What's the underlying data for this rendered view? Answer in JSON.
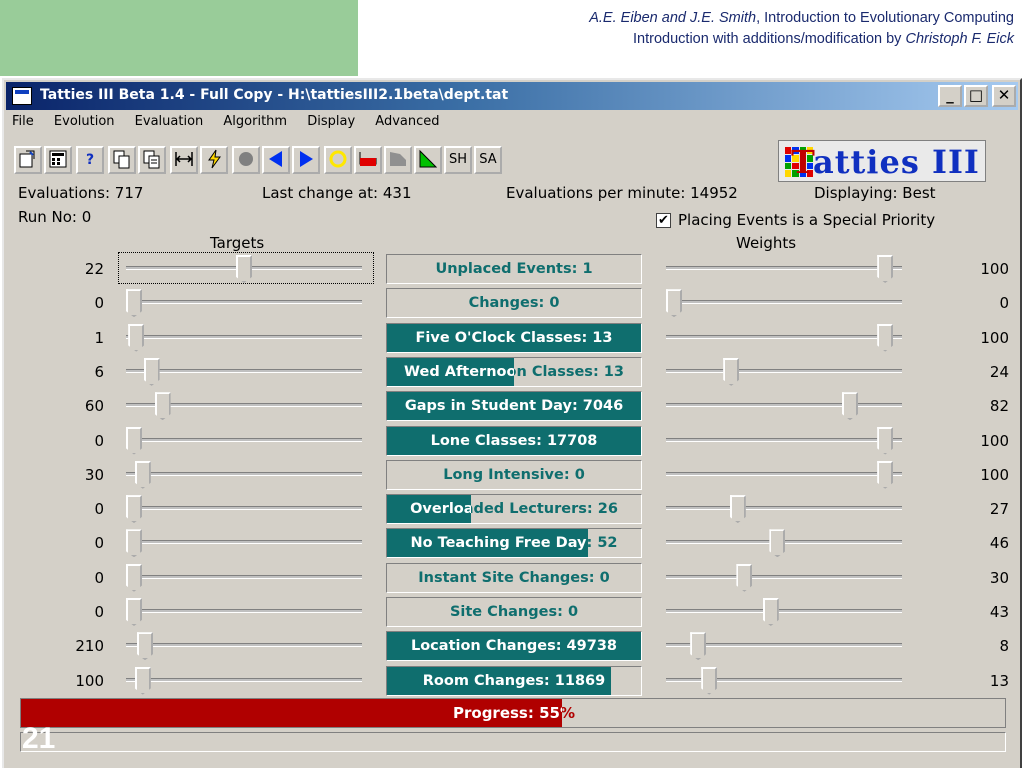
{
  "slide": {
    "line1_italic": "A.E. Eiben and J.E. Smith",
    "line1_rest": ", Introduction to Evolutionary Computing",
    "line2_rest": "Introduction with additions/modification by ",
    "line2_italic": "Christoph F. Eick",
    "slide_number": "21"
  },
  "window": {
    "title": "Tatties III Beta 1.4 - Full Copy - H:\\tattiesIII2.1beta\\dept.tat",
    "min_glyph": "_",
    "max_glyph": "□",
    "close_glyph": "✕"
  },
  "menu": [
    "File",
    "Evolution",
    "Evaluation",
    "Algorithm",
    "Display",
    "Advanced"
  ],
  "toolbar": {
    "sh_label": "SH",
    "sa_label": "SA",
    "help_label": "?"
  },
  "logo": {
    "text": "atties III",
    "t_letter": "T"
  },
  "stats": {
    "evaluations": "Evaluations: 717",
    "last_change": "Last change at: 431",
    "per_minute": "Evaluations per minute: 14952",
    "displaying": "Displaying: Best",
    "run_no": "Run No: 0",
    "priority_label": "Placing Events is a Special Priority",
    "priority_checked": true
  },
  "headers": {
    "targets": "Targets",
    "weights": "Weights"
  },
  "rows": [
    {
      "target": "22",
      "label": "Unplaced Events: 1",
      "weight": "100",
      "t_pos": 0.5,
      "w_pos": 0.96,
      "fill": 0.0
    },
    {
      "target": "0",
      "label": "Changes: 0",
      "weight": "0",
      "t_pos": 0.0,
      "w_pos": 0.0,
      "fill": 0.0
    },
    {
      "target": "1",
      "label": "Five O'Clock Classes: 13",
      "weight": "100",
      "t_pos": 0.01,
      "w_pos": 0.96,
      "fill": 1.0
    },
    {
      "target": "6",
      "label": "Wed Afternoon Classes: 13",
      "weight": "24",
      "t_pos": 0.08,
      "w_pos": 0.26,
      "fill": 0.5
    },
    {
      "target": "60",
      "label": "Gaps in Student Day: 7046",
      "weight": "82",
      "t_pos": 0.13,
      "w_pos": 0.8,
      "fill": 1.0
    },
    {
      "target": "0",
      "label": "Lone Classes: 17708",
      "weight": "100",
      "t_pos": 0.0,
      "w_pos": 0.96,
      "fill": 1.0
    },
    {
      "target": "30",
      "label": "Long Intensive: 0",
      "weight": "100",
      "t_pos": 0.04,
      "w_pos": 0.96,
      "fill": 0.0
    },
    {
      "target": "0",
      "label": "Overloaded Lecturers: 26",
      "weight": "27",
      "t_pos": 0.0,
      "w_pos": 0.29,
      "fill": 0.33
    },
    {
      "target": "0",
      "label": "No Teaching Free Day: 52",
      "weight": "46",
      "t_pos": 0.0,
      "w_pos": 0.47,
      "fill": 0.79
    },
    {
      "target": "0",
      "label": "Instant Site Changes: 0",
      "weight": "30",
      "t_pos": 0.0,
      "w_pos": 0.32,
      "fill": 0.0
    },
    {
      "target": "0",
      "label": "Site Changes: 0",
      "weight": "43",
      "t_pos": 0.0,
      "w_pos": 0.44,
      "fill": 0.0
    },
    {
      "target": "210",
      "label": "Location Changes: 49738",
      "weight": "8",
      "t_pos": 0.05,
      "w_pos": 0.11,
      "fill": 1.0
    },
    {
      "target": "100",
      "label": "Room Changes: 11869",
      "weight": "13",
      "t_pos": 0.04,
      "w_pos": 0.16,
      "fill": 0.88
    }
  ],
  "progress": {
    "label": "Progress: 55%",
    "fraction": 0.55
  },
  "colors": {
    "meter": "#0f6e6e",
    "progress": "#b00000",
    "title_start": "#0a246a"
  }
}
